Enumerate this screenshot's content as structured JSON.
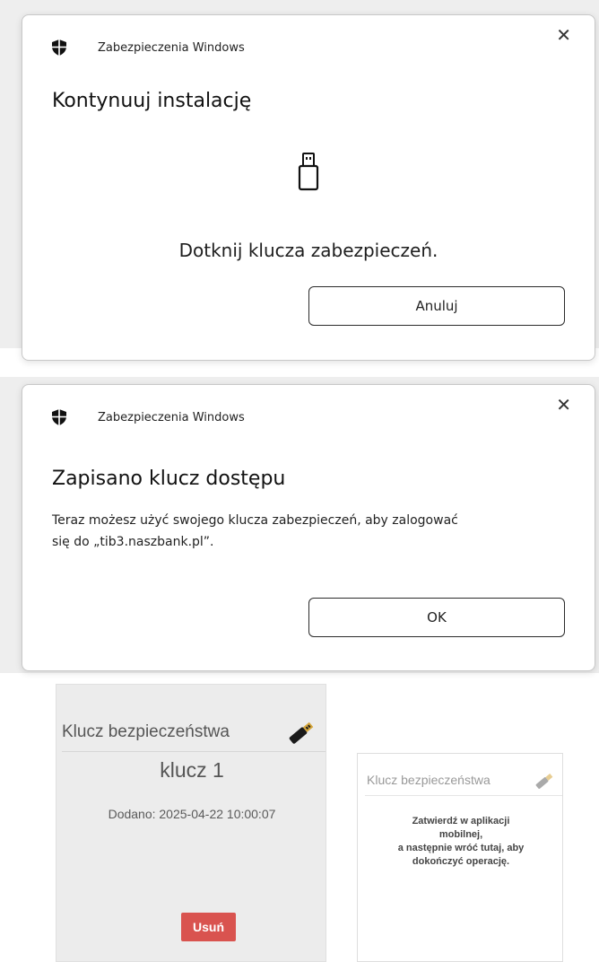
{
  "dialog_touch": {
    "app_name": "Zabezpieczenia Windows",
    "title": "Kontynuuj instalację",
    "instruction": "Dotknij klucza zabezpieczeń.",
    "cancel_label": "Anuluj",
    "close_label": "✕"
  },
  "dialog_saved": {
    "app_name": "Zabezpieczenia Windows",
    "title": "Zapisano klucz dostępu",
    "message_line1": "Teraz możesz użyć swojego klucza zabezpieczeń, aby zalogować",
    "message_line2": "się do „tib3.naszbank.pl”.",
    "ok_label": "OK",
    "close_label": "✕"
  },
  "key_panel": {
    "title": "Klucz bezpieczeństwa",
    "key_name": "klucz 1",
    "added": "Dodano: 2025-04-22 10:00:07",
    "remove_label": "Usuń"
  },
  "confirm_panel": {
    "title": "Klucz bezpieczeństwa",
    "line1": "Zatwierdź w aplikacji",
    "line2": "mobilnej,",
    "line3": "a następnie wróć tutaj, aby",
    "line4": "dokończyć operację."
  },
  "colors": {
    "remove_button": "#d9534f",
    "panel_bg": "#ececec"
  }
}
